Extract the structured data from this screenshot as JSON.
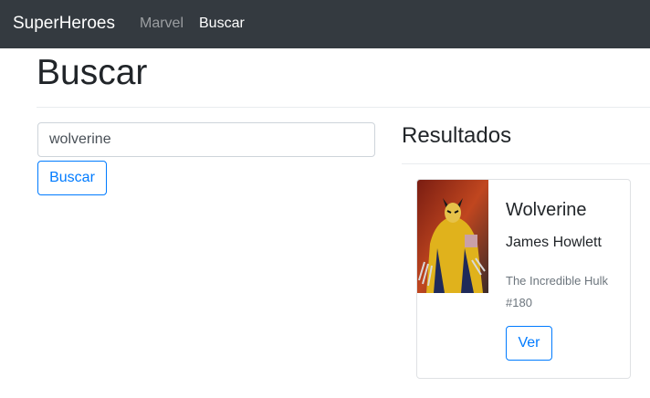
{
  "navbar": {
    "brand": "SuperHeroes",
    "links": [
      {
        "label": "Marvel",
        "active": false
      },
      {
        "label": "Buscar",
        "active": true
      }
    ]
  },
  "page": {
    "title": "Buscar"
  },
  "search": {
    "value": "wolverine",
    "button_label": "Buscar"
  },
  "results": {
    "title": "Resultados",
    "items": [
      {
        "name": "Wolverine",
        "real_name": "James Howlett",
        "first_appearance": "The Incredible Hulk #180",
        "button_label": "Ver",
        "image": "wolverine-comic-cover"
      }
    ]
  },
  "colors": {
    "navbar_bg": "#343a40",
    "primary": "#007bff",
    "muted": "#6c757d"
  }
}
